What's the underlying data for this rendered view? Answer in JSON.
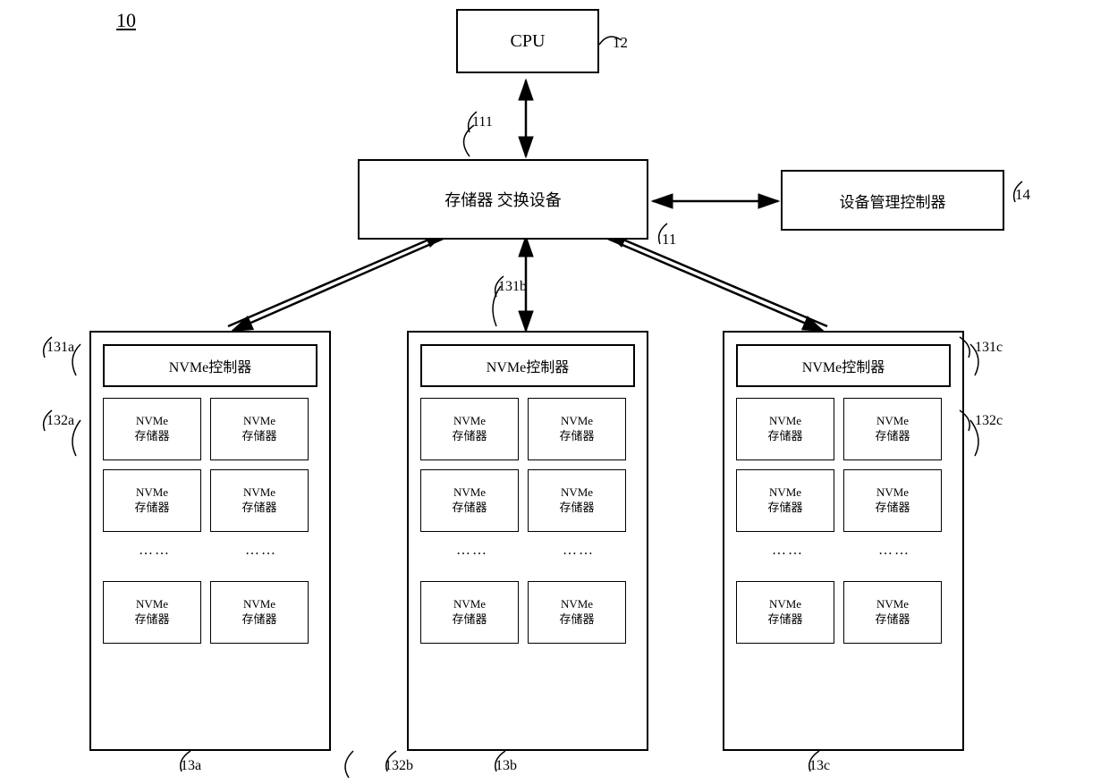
{
  "diagram": {
    "title": "10",
    "cpu": {
      "label": "CPU",
      "ref": "12"
    },
    "switch": {
      "label": "存储器 交换设备",
      "ref": "11",
      "label111": "111"
    },
    "device_mgr": {
      "label": "设备管理控制器",
      "ref": "14"
    },
    "groups": [
      {
        "id": "13a",
        "ref_group": "13a",
        "ref_ctrl": "131a",
        "ref_storage": "132a",
        "controller_label": "NVMe控制器",
        "storage_label": "NVMe\n存储器",
        "dots": "……"
      },
      {
        "id": "13b",
        "ref_group": "13b",
        "ref_ctrl": "131b",
        "ref_storage": "132b",
        "controller_label": "NVMe控制器",
        "storage_label": "NVMe\n存储器",
        "dots": "……"
      },
      {
        "id": "13c",
        "ref_group": "13c",
        "ref_ctrl": "131c",
        "ref_storage": "132c",
        "controller_label": "NVMe控制器",
        "storage_label": "NVMe\n存储器",
        "dots": "……"
      }
    ]
  }
}
